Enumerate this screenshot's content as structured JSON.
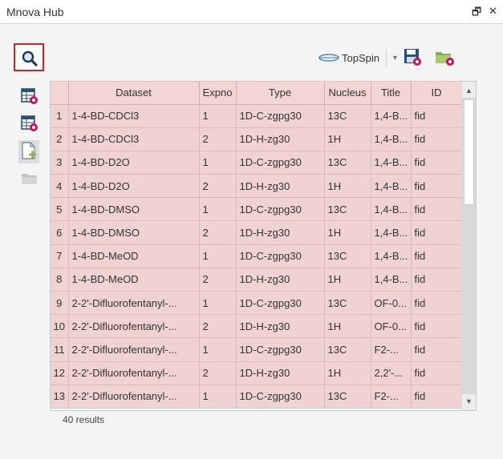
{
  "window": {
    "title": "Mnova Hub",
    "float_glyph": "🗗",
    "close_glyph": "✕"
  },
  "toolbar": {
    "topspin_label": "TopSpin",
    "topspin_caret": "▼"
  },
  "table": {
    "columns": [
      "",
      "Dataset",
      "Expno",
      "Type",
      "Nucleus",
      "Title",
      "ID"
    ],
    "rows": [
      [
        "1",
        "1-4-BD-CDCl3",
        "1",
        "1D-C-zgpg30",
        "13C",
        "1,4-B...",
        "fid"
      ],
      [
        "2",
        "1-4-BD-CDCl3",
        "2",
        "1D-H-zg30",
        "1H",
        "1,4-B...",
        "fid"
      ],
      [
        "3",
        "1-4-BD-D2O",
        "1",
        "1D-C-zgpg30",
        "13C",
        "1,4-B...",
        "fid"
      ],
      [
        "4",
        "1-4-BD-D2O",
        "2",
        "1D-H-zg30",
        "1H",
        "1,4-B...",
        "fid"
      ],
      [
        "5",
        "1-4-BD-DMSO",
        "1",
        "1D-C-zgpg30",
        "13C",
        "1,4-B...",
        "fid"
      ],
      [
        "6",
        "1-4-BD-DMSO",
        "2",
        "1D-H-zg30",
        "1H",
        "1,4-B...",
        "fid"
      ],
      [
        "7",
        "1-4-BD-MeOD",
        "1",
        "1D-C-zgpg30",
        "13C",
        "1,4-B...",
        "fid"
      ],
      [
        "8",
        "1-4-BD-MeOD",
        "2",
        "1D-H-zg30",
        "1H",
        "1,4-B...",
        "fid"
      ],
      [
        "9",
        "2-2'-Difluorofentanyl-...",
        "1",
        "1D-C-zgpg30",
        "13C",
        "OF-0...",
        "fid"
      ],
      [
        "10",
        "2-2'-Difluorofentanyl-...",
        "2",
        "1D-H-zg30",
        "1H",
        "OF-0...",
        "fid"
      ],
      [
        "11",
        "2-2'-Difluorofentanyl-...",
        "1",
        "1D-C-zgpg30",
        "13C",
        "F2-...",
        "fid"
      ],
      [
        "12",
        "2-2'-Difluorofentanyl-...",
        "2",
        "1D-H-zg30",
        "1H",
        "2,2'-...",
        "fid"
      ],
      [
        "13",
        "2-2'-Difluorofentanyl-...",
        "1",
        "1D-C-zgpg30",
        "13C",
        "F2-...",
        "fid"
      ]
    ]
  },
  "scrollbar": {
    "up_glyph": "▲",
    "down_glyph": "▼"
  },
  "status": {
    "results_text": "40 results"
  },
  "icons": {
    "search": "search-icon",
    "save_dataset": "save-dataset-icon",
    "folder_settings": "folder-settings-icon",
    "side_table_filter": "table-filter-icon",
    "side_table_settings": "table-settings-icon",
    "side_new_document": "new-document-icon",
    "side_folder": "folder-icon"
  },
  "colors": {
    "row_bg": "#f1d2d2",
    "header_bg": "#f3d5d6",
    "accent_red": "#c8252c"
  }
}
